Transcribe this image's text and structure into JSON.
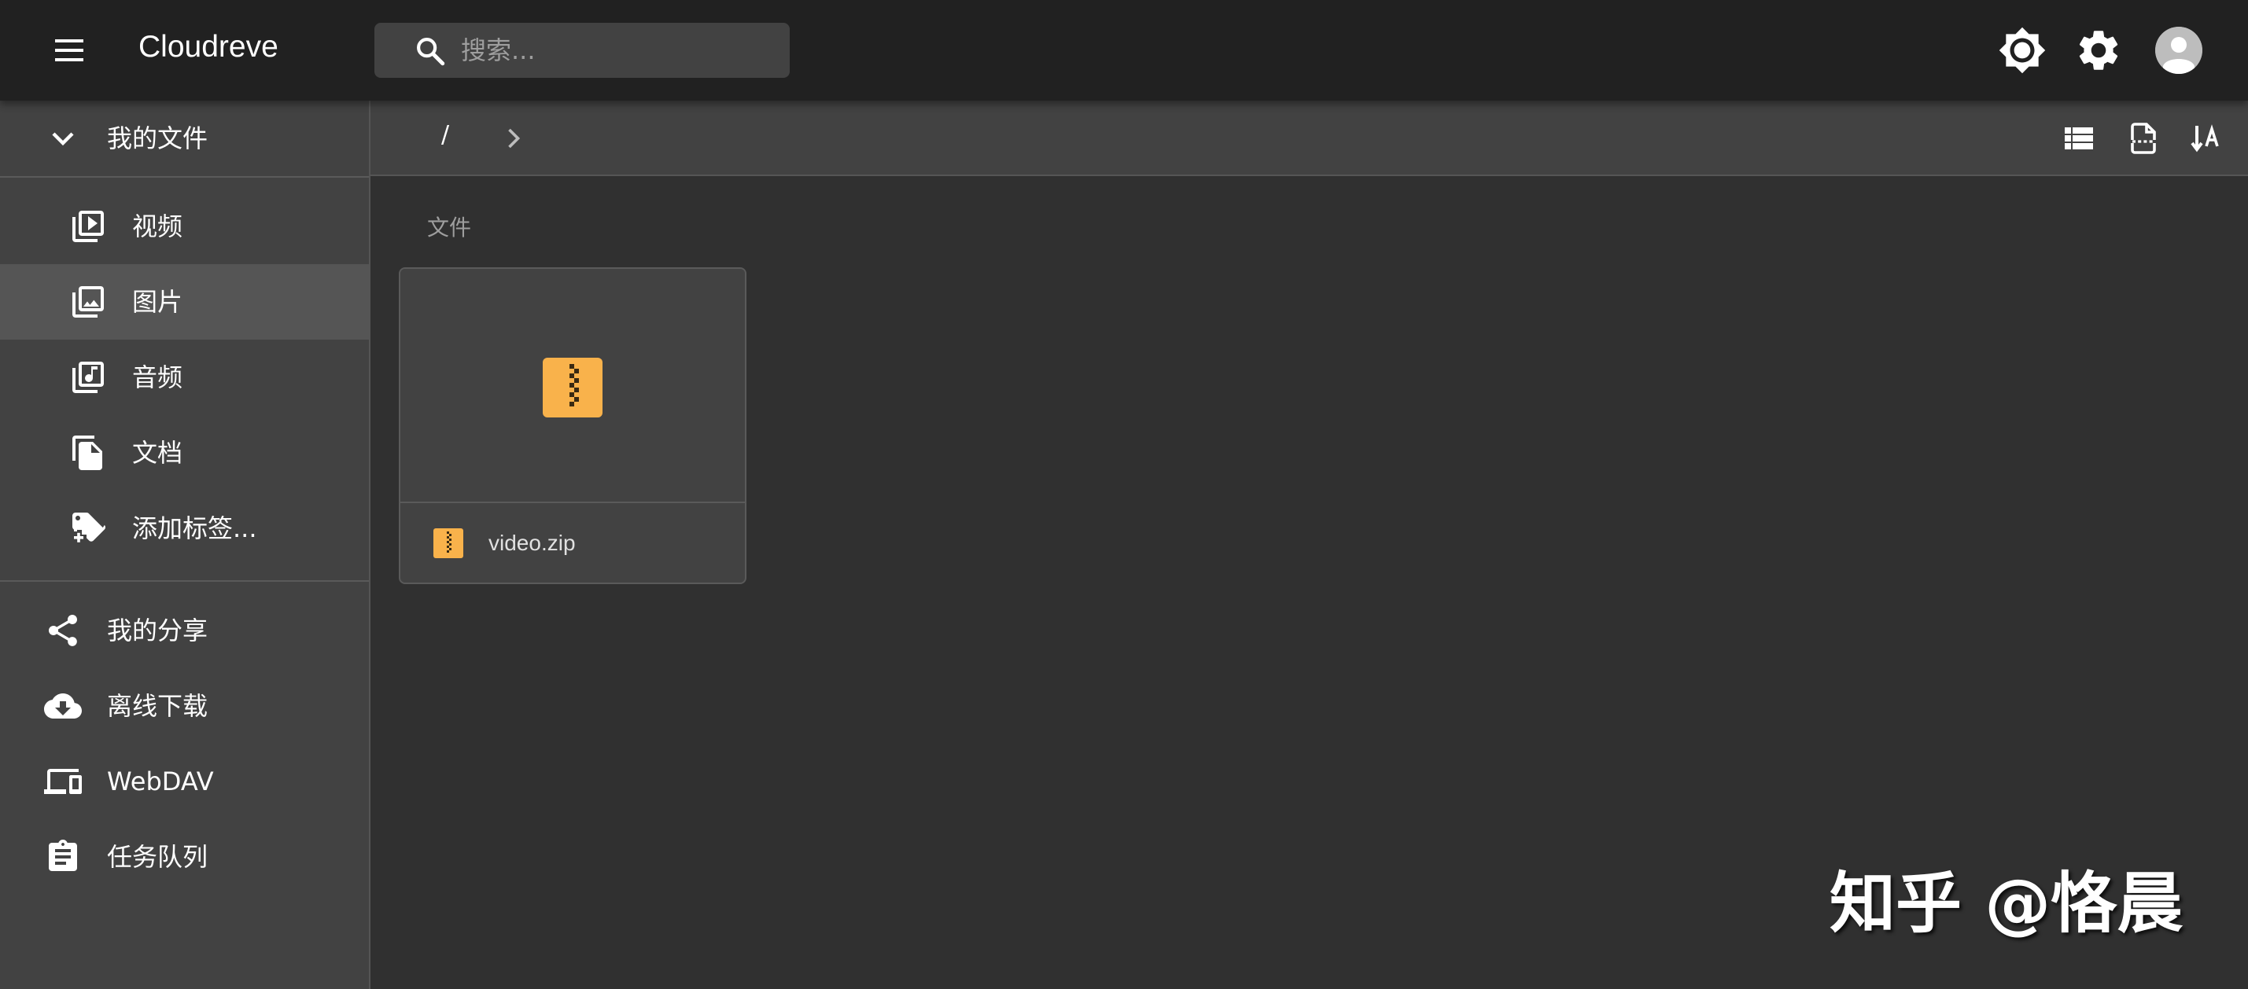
{
  "app": {
    "title": "Cloudreve"
  },
  "search": {
    "placeholder": "搜索...",
    "value": ""
  },
  "header_icons": [
    "menu-icon",
    "search-icon",
    "brightness-icon",
    "gear-icon",
    "account-circle-icon"
  ],
  "sidebar": {
    "my_files_label": "我的文件",
    "sub_items": [
      {
        "label": "视频",
        "icon": "video-library-icon"
      },
      {
        "label": "图片",
        "icon": "photo-library-icon",
        "selected": true
      },
      {
        "label": "音频",
        "icon": "music-library-icon"
      },
      {
        "label": "文档",
        "icon": "file-copy-icon"
      },
      {
        "label": "添加标签...",
        "icon": "add-tag-icon"
      }
    ],
    "items": [
      {
        "label": "我的分享",
        "icon": "share-icon"
      },
      {
        "label": "离线下载",
        "icon": "cloud-download-icon"
      },
      {
        "label": "WebDAV",
        "icon": "devices-icon"
      },
      {
        "label": "任务队列",
        "icon": "clipboard-list-icon"
      }
    ]
  },
  "breadcrumb": {
    "root": "/"
  },
  "toolbar_icons": [
    "list-view-icon",
    "file-outline-icon",
    "sort-alpha-icon"
  ],
  "main": {
    "section_label": "文件",
    "files": [
      {
        "name": "video.zip",
        "icon": "zip-file-icon"
      }
    ]
  },
  "watermark": "知乎 @恪晨",
  "colors": {
    "appbar": "#212121",
    "sidebar": "#424242",
    "background": "#303030",
    "selected_row": "#555555",
    "zip_accent": "#f9b24b"
  }
}
